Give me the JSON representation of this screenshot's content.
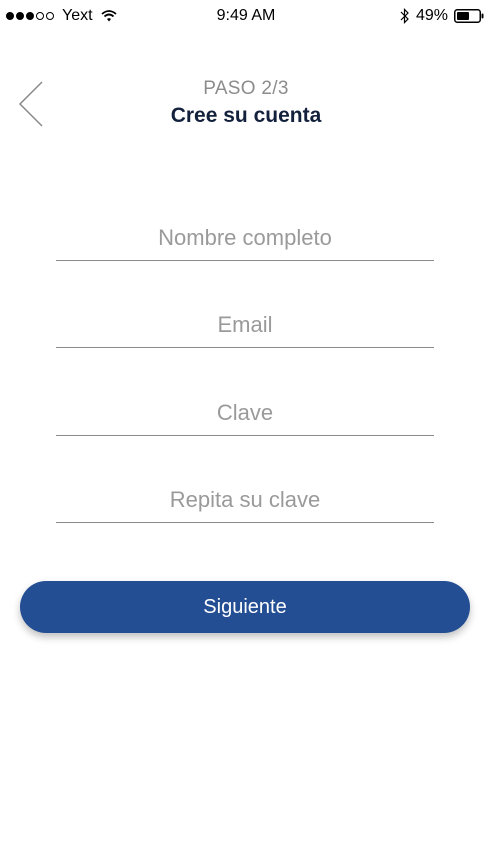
{
  "status_bar": {
    "carrier": "Yext",
    "time": "9:49 AM",
    "battery": "49%",
    "signal_bars_filled": 3,
    "signal_bars_total": 5,
    "icons": [
      "wifi-icon",
      "bluetooth-icon",
      "battery-icon"
    ]
  },
  "header": {
    "back_icon": "chevron-left-icon",
    "step": "PASO 2/3",
    "title": "Cree su cuenta"
  },
  "form": {
    "full_name": {
      "placeholder": "Nombre completo",
      "value": ""
    },
    "email": {
      "placeholder": "Email",
      "value": ""
    },
    "password": {
      "placeholder": "Clave",
      "value": ""
    },
    "password_repeat": {
      "placeholder": "Repita su clave",
      "value": ""
    }
  },
  "actions": {
    "next_label": "Siguiente"
  },
  "colors": {
    "primary_button": "#234e93",
    "title": "#14213d",
    "step_label": "#8c8c8c",
    "placeholder": "#9a9a9a",
    "underline": "#8a8a8a"
  }
}
